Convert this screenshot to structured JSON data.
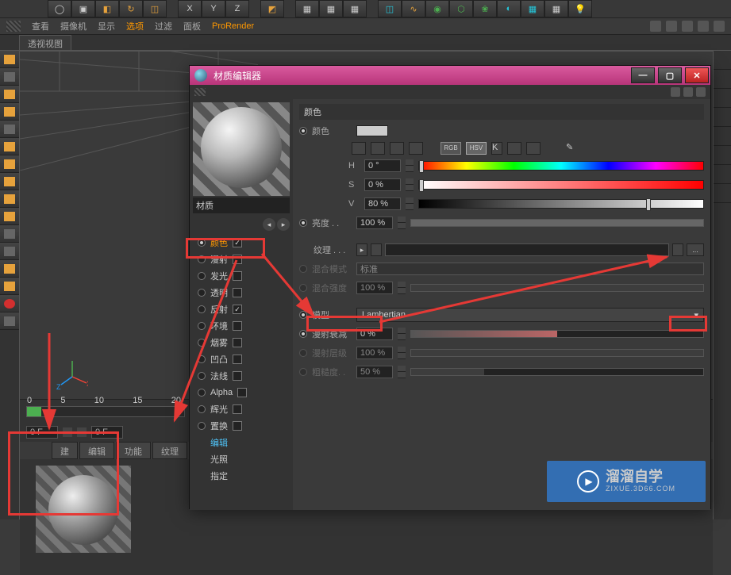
{
  "menu": {
    "view": "查看",
    "camera": "摄像机",
    "display": "显示",
    "options": "选项",
    "filter": "过滤",
    "panel": "面板",
    "prorender": "ProRender"
  },
  "viewport_tab": "透视视图",
  "axes": {
    "x": "X",
    "y": "Y",
    "z": "Z"
  },
  "timeline": {
    "ticks": [
      "0",
      "5",
      "10",
      "15",
      "20"
    ],
    "frame_a": "0 F",
    "frame_b": "0 F"
  },
  "bottom_tabs": {
    "create": "建",
    "edit": "编辑",
    "func": "功能",
    "texture": "纹理"
  },
  "editor": {
    "title": "材质编辑器",
    "material_name": "材质",
    "channels": {
      "color": "颜色",
      "diffuse": "漫射",
      "luminance": "发光",
      "transparency": "透明",
      "reflection": "反射",
      "environment": "环境",
      "fog": "烟雾",
      "bump": "凹凸",
      "normal": "法线",
      "alpha": "Alpha",
      "glow": "辉光",
      "displacement": "置换",
      "edit": "编辑",
      "illumination": "光照",
      "assign": "指定"
    },
    "section": "颜色",
    "labels": {
      "color": "颜色",
      "h": "H",
      "s": "S",
      "v": "V",
      "brightness": "亮度 . .",
      "texture": "纹理 . . .",
      "blend_mode": "混合模式",
      "blend_strength": "混合强度",
      "model": "模型 . .",
      "diff_falloff": "漫射衰减",
      "diff_level": "漫射层级",
      "roughness": "粗糙度. ."
    },
    "values": {
      "h": "0 °",
      "s": "0 %",
      "v": "80 %",
      "brightness": "100 %",
      "blend_mode": "标准",
      "blend_strength": "100 %",
      "model": "Lambertian",
      "diff_falloff": "0 %",
      "diff_level": "100 %",
      "roughness": "50 %"
    },
    "rgb": "RGB",
    "hsv": "HSV",
    "k": "K"
  },
  "watermark": {
    "brand": "溜溜自学",
    "url": "ZIXUE.3D66.COM"
  }
}
